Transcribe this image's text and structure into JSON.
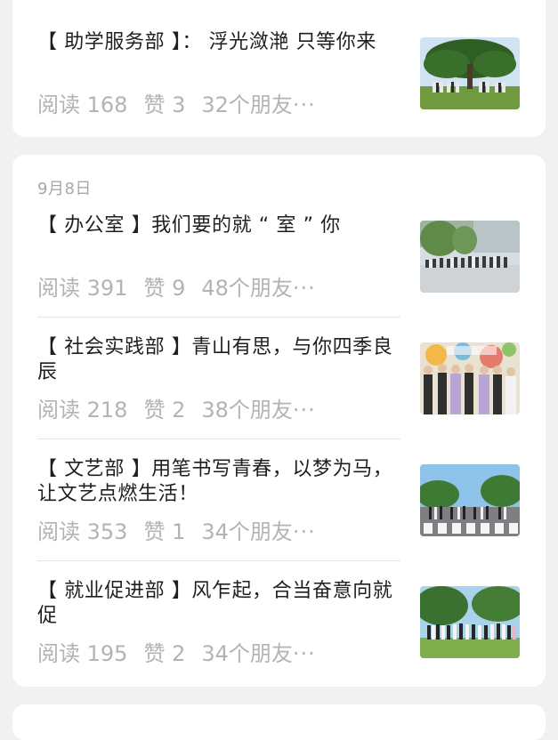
{
  "top_card": {
    "article": {
      "title": "【 助学服务部 】： 浮光潋滟 只等你来",
      "reads": "阅读 168",
      "likes": "赞 3",
      "friends": "32个朋友",
      "more": "···",
      "thumbnail": "photo-tree-group"
    }
  },
  "main_card": {
    "date": "9月8日",
    "articles": [
      {
        "title": "【 办公室 】我们要的就 “ 室 ” 你",
        "reads": "阅读 391",
        "likes": "赞 9",
        "friends": "48个朋友",
        "more": "···",
        "thumbnail": "photo-plaza-group"
      },
      {
        "title": "【 社会实践部 】青山有思，与你四季良辰",
        "reads": "阅读 218",
        "likes": "赞 2",
        "friends": "38个朋友",
        "more": "···",
        "thumbnail": "photo-museum-group"
      },
      {
        "title": "【 文艺部 】用笔书写青春，以梦为马，让文艺点燃生活！",
        "reads": "阅读 353",
        "likes": "赞 1",
        "friends": "34个朋友",
        "more": "···",
        "thumbnail": "photo-crosswalk-group"
      },
      {
        "title": "【 就业促进部 】风乍起，合当奋意向就促",
        "reads": "阅读 195",
        "likes": "赞 2",
        "friends": "34个朋友",
        "more": "···",
        "thumbnail": "photo-park-group"
      }
    ]
  }
}
